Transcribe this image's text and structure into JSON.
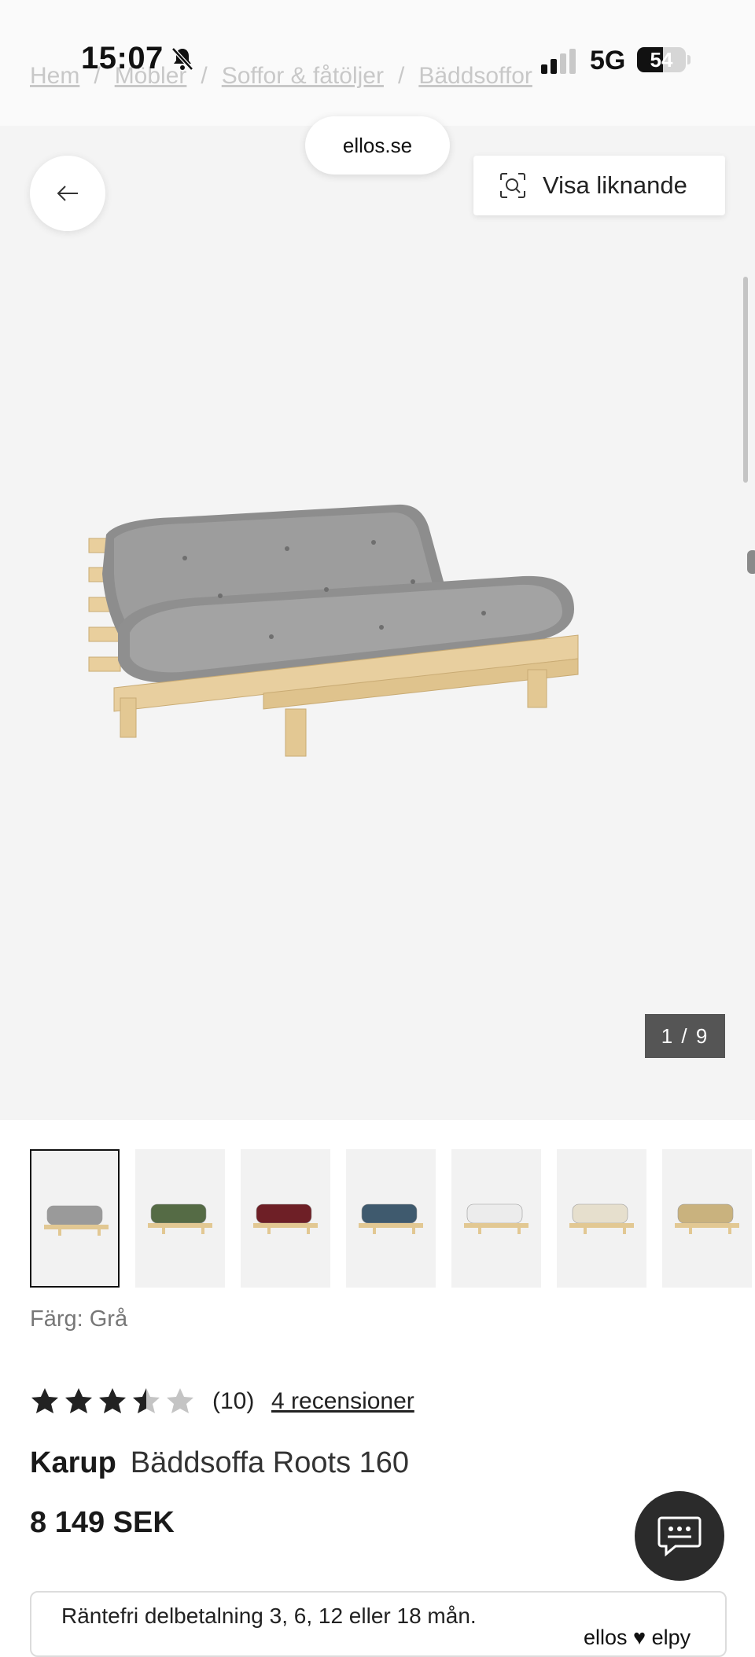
{
  "status_bar": {
    "time": "15:07",
    "network": "5G",
    "battery": "54",
    "battery_level_pct": 54
  },
  "breadcrumb": [
    "Hem",
    "Möbler",
    "Soffor & fåtöljer",
    "Bäddsoffor"
  ],
  "url": "ellos.se",
  "gallery": {
    "similar_label": "Visa liknande",
    "counter": "1 / 9",
    "thumbnail_colors": [
      "#9a9a9a",
      "#556b45",
      "#6e1f26",
      "#3f5a6e",
      "#ececec",
      "#e6dfcd",
      "#c9b27e"
    ]
  },
  "product": {
    "color_label": "Färg: Grå",
    "rating_value": 3.5,
    "rating_count": "(10)",
    "reviews_link": "4 recensioner",
    "brand": "Karup",
    "name": "Bäddsoffa Roots 160",
    "price": "8 149 SEK"
  },
  "payment": {
    "text": "Räntefri delbetalning 3, 6, 12 eller 18 mån.",
    "logo": "ellos ♥ elpy"
  },
  "icons": {
    "back": "arrow-left-icon",
    "similar": "visual-search-icon",
    "chat": "chat-icon",
    "bell": "bell-slash-icon"
  }
}
